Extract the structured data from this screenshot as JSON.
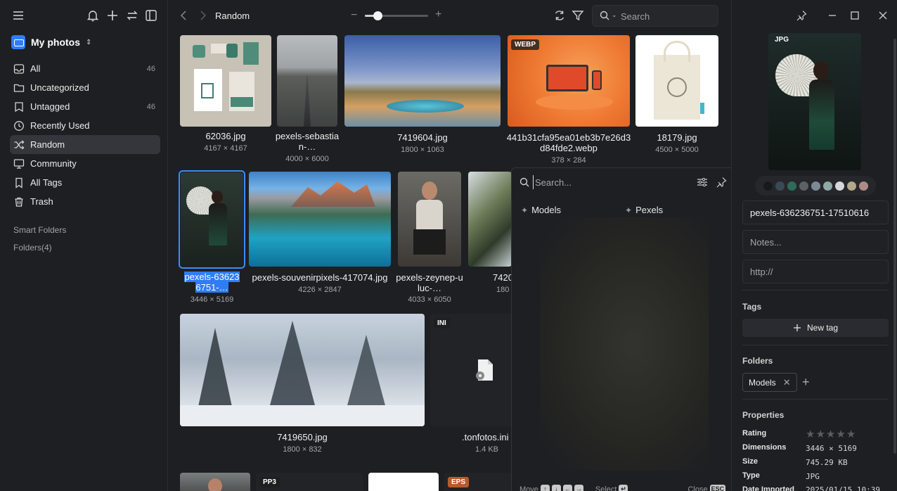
{
  "library": {
    "name": "My photos"
  },
  "sidebar": {
    "items": [
      {
        "label": "All",
        "count": "46",
        "icon": "inbox-icon"
      },
      {
        "label": "Uncategorized",
        "count": "",
        "icon": "folder-icon"
      },
      {
        "label": "Untagged",
        "count": "46",
        "icon": "tag-off-icon"
      },
      {
        "label": "Recently Used",
        "count": "",
        "icon": "clock-icon"
      },
      {
        "label": "Random",
        "count": "",
        "icon": "shuffle-icon"
      },
      {
        "label": "Community",
        "count": "",
        "icon": "community-icon"
      },
      {
        "label": "All Tags",
        "count": "",
        "icon": "bookmark-icon"
      },
      {
        "label": "Trash",
        "count": "",
        "icon": "trash-icon"
      }
    ],
    "smart_folders": "Smart Folders",
    "folders": "Folders(4)"
  },
  "topbar": {
    "title": "Random",
    "search_placeholder": "Search",
    "zoom_percent": 20
  },
  "grid": {
    "items": [
      {
        "name": "62036.jpg",
        "dims": "4167 × 4167",
        "badge": ""
      },
      {
        "name": "pexels-sebastian-…",
        "dims": "4000 × 6000",
        "badge": ""
      },
      {
        "name": "7419604.jpg",
        "dims": "1800 × 1063",
        "badge": ""
      },
      {
        "name": "441b31cfa95ea01eb3b7e26d3d84fde2.webp",
        "dims": "378 × 284",
        "badge": "WEBP"
      },
      {
        "name": "18179.jpg",
        "dims": "4500 × 5000",
        "badge": ""
      },
      {
        "name": "pexels-636236751-…",
        "dims": "3446 × 5169",
        "badge": ""
      },
      {
        "name": "pexels-souvenirpixels-417074.jpg",
        "dims": "4226 × 2847",
        "badge": ""
      },
      {
        "name": "pexels-zeynep-uluc-…",
        "dims": "4033 × 6050",
        "badge": ""
      },
      {
        "name": "7420",
        "dims": "180",
        "badge": ""
      },
      {
        "name": "7419650.jpg",
        "dims": "1800 × 832",
        "badge": ""
      },
      {
        "name": ".tonfotos.ini",
        "dims": "1.4 KB",
        "badge": "INI"
      },
      {
        "name": "",
        "dims": "",
        "badge": ""
      },
      {
        "name": "",
        "dims": "",
        "badge": "PP3"
      },
      {
        "name": "",
        "dims": "",
        "badge": ""
      },
      {
        "name": "",
        "dims": "",
        "badge": "EPS"
      }
    ]
  },
  "popup": {
    "search_placeholder": "Search...",
    "tags": [
      "Models",
      "Pexels"
    ],
    "footer": {
      "move": "Move",
      "select": "Select",
      "close": "Close",
      "esc": "ESC"
    }
  },
  "inspector": {
    "format_badge": "JPG",
    "palette": [
      "#151a1b",
      "#3a4a55",
      "#2f6b5c",
      "#5e6164",
      "#7c8a94",
      "#8fa9a6",
      "#d4d8d8",
      "#b0a888",
      "#b08a86"
    ],
    "filename": "pexels-636236751-17510616",
    "notes_placeholder": "Notes...",
    "url_placeholder": "http://",
    "tags_title": "Tags",
    "new_tag": "New tag",
    "folders_title": "Folders",
    "folder_chip": "Models",
    "properties_title": "Properties",
    "properties": [
      {
        "key": "Rating",
        "value": ""
      },
      {
        "key": "Dimensions",
        "value": "3446 × 5169"
      },
      {
        "key": "Size",
        "value": "745.29 KB"
      },
      {
        "key": "Type",
        "value": "JPG"
      },
      {
        "key": "Date Imported",
        "value": "2025/01/15 10:39"
      }
    ],
    "rating": 0
  }
}
